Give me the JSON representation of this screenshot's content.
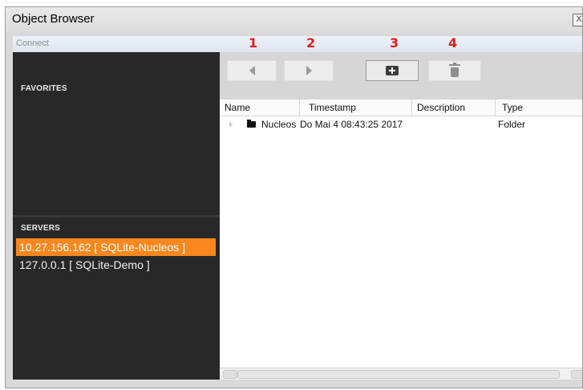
{
  "window": {
    "title": "Object Browser",
    "close_label": "X"
  },
  "menu": {
    "connect_label": "Connect"
  },
  "sidebar": {
    "favorites_label": "FAVORITES",
    "servers_label": "SERVERS",
    "servers": [
      {
        "label": "10.27.156.162 [ SQLite-Nucleos ]",
        "selected": true
      },
      {
        "label": "127.0.0.1 [ SQLite-Demo ]",
        "selected": false
      }
    ]
  },
  "toolbar": {
    "buttons": [
      {
        "icon": "back-arrow-icon",
        "annotation": "1"
      },
      {
        "icon": "forward-arrow-icon",
        "annotation": "2"
      },
      {
        "icon": "new-folder-icon",
        "annotation": "3"
      },
      {
        "icon": "trash-icon",
        "annotation": "4"
      }
    ]
  },
  "table": {
    "columns": [
      "Name",
      "Timestamp",
      "Description",
      "Type"
    ],
    "rows": [
      {
        "name": "Nucleos",
        "timestamp": "Do Mai 4 08:43:25 2017",
        "description": "",
        "type": "Folder"
      }
    ]
  },
  "colors": {
    "selection": "#f7871e",
    "sidebar_bg": "#282828",
    "annotation": "#e11d1d"
  }
}
